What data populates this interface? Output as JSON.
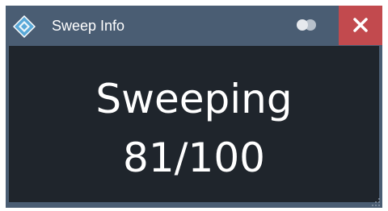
{
  "window": {
    "title": "Sweep Info"
  },
  "icons": {
    "app": "rohde-schwarz-logo-icon",
    "toggle": "toggle-switch-icon",
    "close": "close-icon",
    "grip": "resize-grip-icon"
  },
  "colors": {
    "titlebar": "#4a5d73",
    "close_button": "#c24a4e",
    "content_background": "#1f252c",
    "text": "#ffffff",
    "logo": "#5aa9d8"
  },
  "status": {
    "label": "Sweeping",
    "progress": "81/100"
  }
}
